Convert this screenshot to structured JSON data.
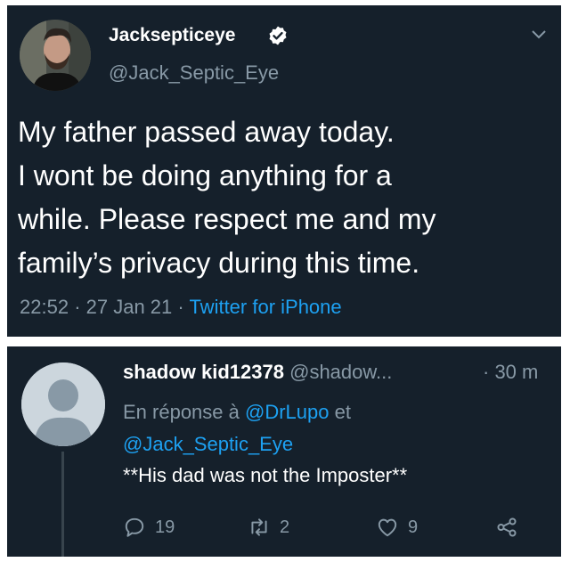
{
  "tweet": {
    "display_name": "Jacksepticeye",
    "handle": "@Jack_Septic_Eye",
    "text_lines": [
      "My father passed away today.",
      "I wont be doing anything for a",
      "while. Please respect me and my",
      "family’s privacy during this time."
    ],
    "time": "22:52",
    "date": "27 Jan 21",
    "source": "Twitter for iPhone",
    "sep": "·"
  },
  "reply": {
    "display_name": "shadow kid12378",
    "handle": "@shadow...",
    "time": "· 30 m",
    "reply_prefix": "En réponse à",
    "mention1": "@DrLupo",
    "conj": "et",
    "mention2": "@Jack_Septic_Eye",
    "text": "**His dad was not the Imposter**",
    "replies": "19",
    "retweets": "2",
    "likes": "9"
  },
  "colors": {
    "background": "#15202b",
    "accent": "#1da1f2",
    "muted": "#8899a6"
  },
  "icons": [
    "verified-badge-icon",
    "chevron-down-icon",
    "reply-icon",
    "retweet-icon",
    "like-icon",
    "share-icon",
    "default-avatar-icon"
  ]
}
